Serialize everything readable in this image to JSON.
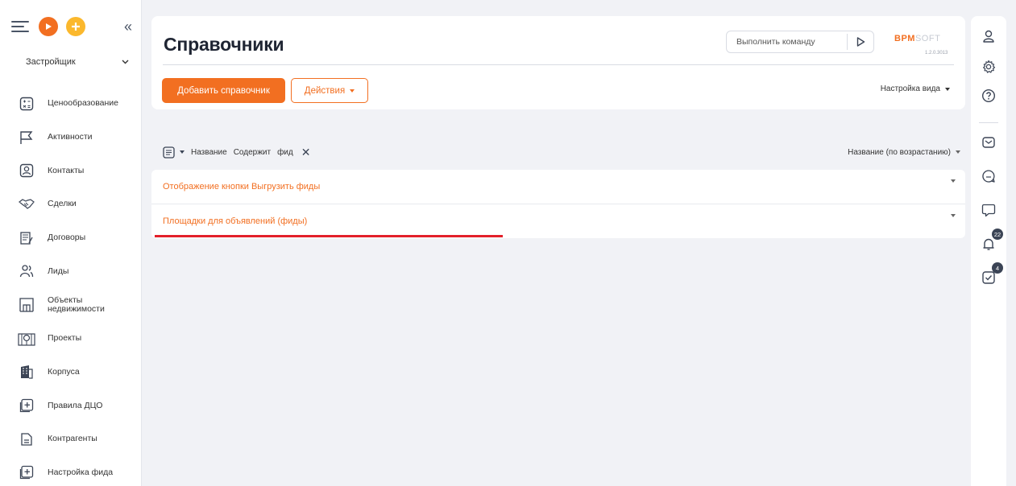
{
  "sidebar": {
    "workplace": "Застройщик",
    "items": [
      {
        "label": "Ценообразование",
        "icon": "pricing-icon"
      },
      {
        "label": "Активности",
        "icon": "flag-icon"
      },
      {
        "label": "Контакты",
        "icon": "contact-icon"
      },
      {
        "label": "Сделки",
        "icon": "handshake-icon"
      },
      {
        "label": "Договоры",
        "icon": "contract-icon"
      },
      {
        "label": "Лиды",
        "icon": "leads-icon"
      },
      {
        "label": "Объекты недвижимости",
        "icon": "property-icon"
      },
      {
        "label": "Проекты",
        "icon": "projects-icon"
      },
      {
        "label": "Корпуса",
        "icon": "building-icon"
      },
      {
        "label": "Правила ДЦО",
        "icon": "rules-icon"
      },
      {
        "label": "Контрагенты",
        "icon": "accounts-icon"
      },
      {
        "label": "Настройка фида",
        "icon": "feed-settings-icon"
      }
    ]
  },
  "header": {
    "title": "Справочники",
    "command_placeholder": "Выполнить команду",
    "logo_main": "BPM",
    "logo_soft": "SOFT",
    "version": "1.2.0.3013"
  },
  "toolbar": {
    "add_label": "Добавить справочник",
    "actions_label": "Действия",
    "view_setup_label": "Настройка вида"
  },
  "filter": {
    "field": "Название",
    "operator": "Содержит",
    "value": "фид",
    "sort_label": "Название (по возрастанию)"
  },
  "list": {
    "rows": [
      {
        "title": "Отображение кнопки Выгрузить фиды"
      },
      {
        "title": "Площадки для объявлений (фиды)"
      }
    ]
  },
  "right_panel": {
    "notifications_count": "22",
    "tasks_count": "4"
  },
  "colors": {
    "accent": "#f26f21",
    "secondary_accent": "#fbb82d",
    "highlight_underline": "#e3202a"
  }
}
